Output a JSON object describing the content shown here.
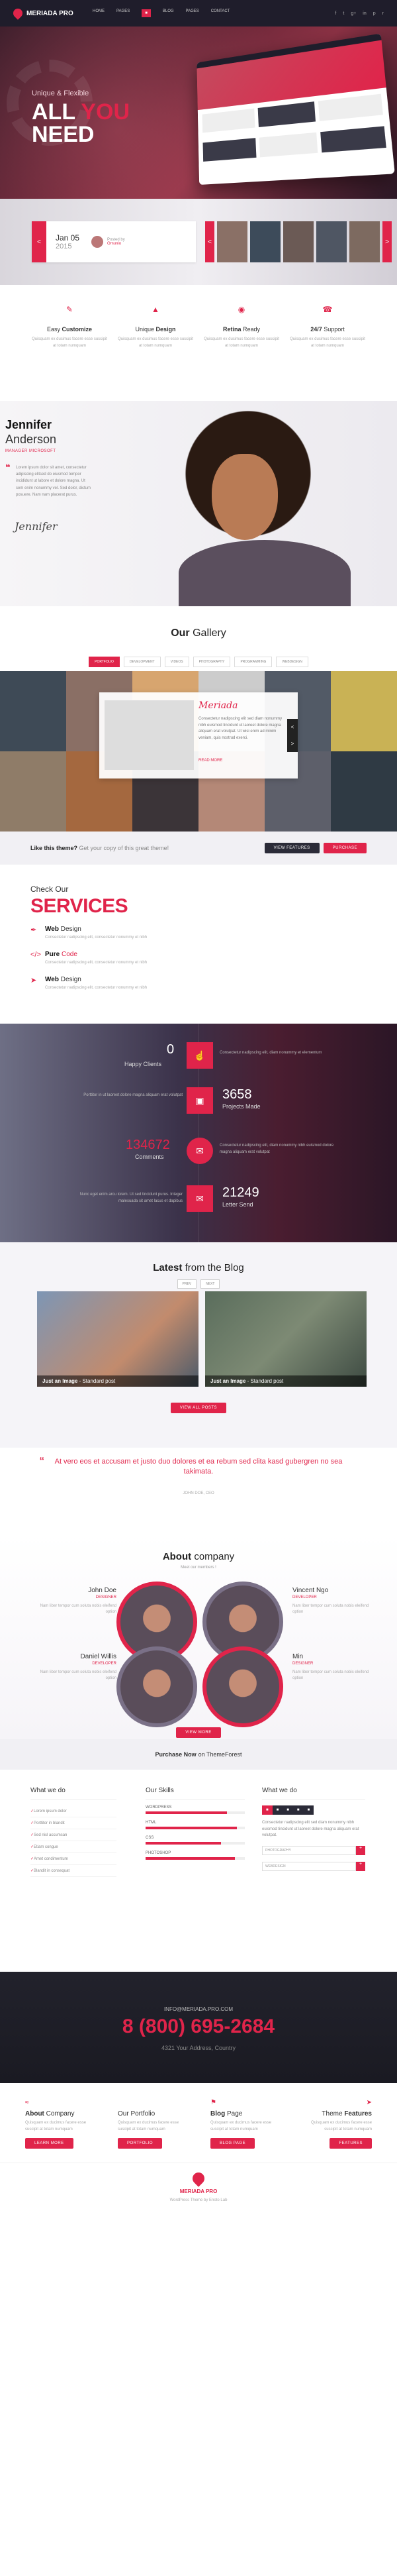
{
  "header": {
    "logo": "MERIADA PRO",
    "nav": [
      "HOME",
      "PAGES",
      "",
      "BLOG",
      "",
      "",
      "PAGES",
      "CONTACT"
    ],
    "social": [
      "f",
      "t",
      "g+",
      "in",
      "p",
      "r"
    ]
  },
  "hero": {
    "tagline": "Unique & Flexible",
    "headline_1": "ALL",
    "headline_2": "YOU",
    "headline_3": "NEED"
  },
  "strip": {
    "date_top": "Jan 05",
    "date_bottom": "2015",
    "author_label": "Posted by",
    "author_name": "Omunio",
    "prev": "<",
    "next": ">"
  },
  "features": [
    {
      "icon": "pencil-icon",
      "light": "Easy",
      "bold": "Customize",
      "desc": "Quisquam ex ducimus facere esse\nsuscipit at totam numquam"
    },
    {
      "icon": "design-icon",
      "light": "Unique",
      "bold": "Design",
      "desc": "Quisquam ex ducimus facere esse\nsuscipit at totam numquam"
    },
    {
      "icon": "retina-icon",
      "light": "",
      "bold": "Retina",
      "suffix": "Ready",
      "desc": "Quisquam ex ducimus facere esse\nsuscipit at totam numquam"
    },
    {
      "icon": "support-icon",
      "light": "",
      "bold": "24/7",
      "suffix": "Support",
      "desc": "Quisquam ex ducimus facere esse\nsuscipit at totam numquam"
    }
  ],
  "member": {
    "first": "Jennifer",
    "last": "Anderson",
    "role": "MANAGER MICROSOFT",
    "quote": "Lorem ipsum dolor sit amet, consectetur adipiscing elitsed do eiusmod tempor incididunt ut labore et dolore magna. Ut sem enim nonummy vel. Sed dolor, dictum posuere. Nam nam placerat purus.",
    "signature": "Jennifer"
  },
  "gallery": {
    "title_1": "Our",
    "title_2": "Gallery",
    "filters": [
      "PORTFOLIO",
      "DEVELOPMENT",
      "VIDEOS",
      "PHOTOGRAPHY",
      "PROGRAMMING",
      "WEBDESIGN"
    ],
    "card_name": "Meriada",
    "card_text": "Consectetur nadipscing elit sed diam nonummy nibh euismod tincidunt ut laoreet dolore magna aliquam erat volutpat. Ut wisi enim ad minim veniam, quis nostrud exerci.",
    "card_link": "READ MORE",
    "card_prev": "<",
    "card_next": ">"
  },
  "cta": {
    "bold": "Like this theme?",
    "rest": "Get your copy of this great theme!",
    "btn1": "VIEW FEATURES",
    "btn2": "PURCHASE"
  },
  "services": {
    "lead": "Check Our",
    "title": "SERVICES",
    "items": [
      {
        "icon": "pen-icon",
        "bold": "Web",
        "light": "Design",
        "desc": "Consectetur nadipscing elit, consectetur nonummy et nibh"
      },
      {
        "icon": "code-icon",
        "bold": "Pure",
        "light": "Code",
        "desc": "Consectetur nadipscing elit, consectetur nonummy et nibh"
      },
      {
        "icon": "plane-icon",
        "bold": "Web",
        "light": "Design",
        "desc": "Consectetur nadipscing elit, consectetur nonummy et nibh"
      }
    ]
  },
  "stats": [
    {
      "num": "0",
      "label": "Happy Clients",
      "icon": "thumb-icon",
      "text": "Consectetur nadipscing elit, diam nonummy et elementum"
    },
    {
      "num": "3658",
      "label": "Projects Made",
      "icon": "laptop-icon",
      "text": "Porttitor in ut laoreet dolore magna aliquam erat volutpat"
    },
    {
      "num": "134672",
      "label": "Comments",
      "icon": "chat-icon",
      "text": "Consectetur nadipscing elit, diam nonummy nibh euismod dolore magna aliquam erat volutpat"
    },
    {
      "num": "21249",
      "label": "Letter Send",
      "icon": "mail-icon",
      "text": "Nunc eget enim arcu lorem. Ut sed tincidunt purus. Integer malesuada sit amet lacus et dapibus"
    }
  ],
  "blog": {
    "title_1": "Latest",
    "title_2": "from the Blog",
    "prev": "PREV",
    "next": "NEXT",
    "posts": [
      {
        "bold": "Just an Image",
        "light": "Standard post"
      },
      {
        "bold": "Just an Image",
        "light": "Standard post"
      }
    ],
    "more": "VIEW ALL POSTS"
  },
  "testimonial": {
    "quote": "At vero eos et accusam et justo duo dolores et ea rebum sed clita kasd gubergren no sea takimata.",
    "author": "JOHN DOE, CEO"
  },
  "about": {
    "title_1": "About",
    "title_2": "company",
    "sub": "Meet our members !",
    "people": [
      {
        "name": "John Doe",
        "role": "DESIGNER",
        "desc": "Nam liber tempor cum soluta nobis eleifend option"
      },
      {
        "name": "Vincent Ngo",
        "role": "DEVELOPER",
        "desc": "Nam liber tempor cum soluta nobis eleifend option"
      },
      {
        "name": "Daniel Willis",
        "role": "DEVELOPER",
        "desc": "Nam liber tempor cum soluta nobis eleifend option"
      },
      {
        "name": "Min",
        "role": "DESIGNER",
        "desc": "Nam liber tempor cum soluta nobis eleifend option"
      }
    ],
    "more": "VIEW MORE"
  },
  "purchase": {
    "bold": "Purchase Now",
    "rest": "on ThemeForest"
  },
  "info": {
    "col1_title": "What we do",
    "col1_items": [
      "Lorem ipsum dolor",
      "Porttitor in blandit",
      "Sed nisl accumsan",
      "Etiam congue",
      "Amet condimentum",
      "Blandit in consequat"
    ],
    "col2_title": "Our Skills",
    "skills": [
      {
        "label": "WORDPRESS",
        "pct": 0.82
      },
      {
        "label": "HTML",
        "pct": 0.92
      },
      {
        "label": "CSS",
        "pct": 0.76
      },
      {
        "label": "PHOTOSHOP",
        "pct": 0.9
      }
    ],
    "col3_title": "What we do",
    "tabs": [
      "",
      "",
      "",
      "",
      ""
    ],
    "tab_text": "Consectetur nadipscing elit sed diam nonummy nibh euismod tincidunt ut laoreet dolore magna aliquam erat volutpat.",
    "input_1": "PHOTOGRAPHY",
    "input_2": "WEBDESIGN",
    "input_btn": "+"
  },
  "contact": {
    "email": "INFO@MERIADA.PRO.COM",
    "phone": "8 (800) 695-2684",
    "address": "4321 Your Address, Country"
  },
  "footer_cols": [
    {
      "icon": "wifi-icon",
      "bold": "About",
      "light": "Company",
      "desc": "Quisquam ex ducimus facere esse suscipit at totam numquam",
      "btn": "LEARN MORE"
    },
    {
      "icon": "",
      "bold": "",
      "light": "Our Portfolio",
      "desc": "Quisquam ex ducimus facere esse suscipit at totam numquam",
      "btn": "PORTFOLIO"
    },
    {
      "icon": "flag-icon",
      "bold": "Blog",
      "light": "Page",
      "desc": "Quisquam ex ducimus facere esse suscipit at totam numquam",
      "btn": "BLOG PAGE"
    },
    {
      "icon": "plane-icon",
      "bold": "Features",
      "light": "Theme",
      "desc": "Quisquam ex ducimus facere esse suscipit at totam numquam",
      "btn": "FEATURES"
    }
  ],
  "bottom": {
    "name": "MERIADA PRO",
    "copyright": "WordPress Theme by Enoto Lab"
  },
  "colors": {
    "accent": "#e0244a",
    "dark": "#1f1d2b"
  }
}
